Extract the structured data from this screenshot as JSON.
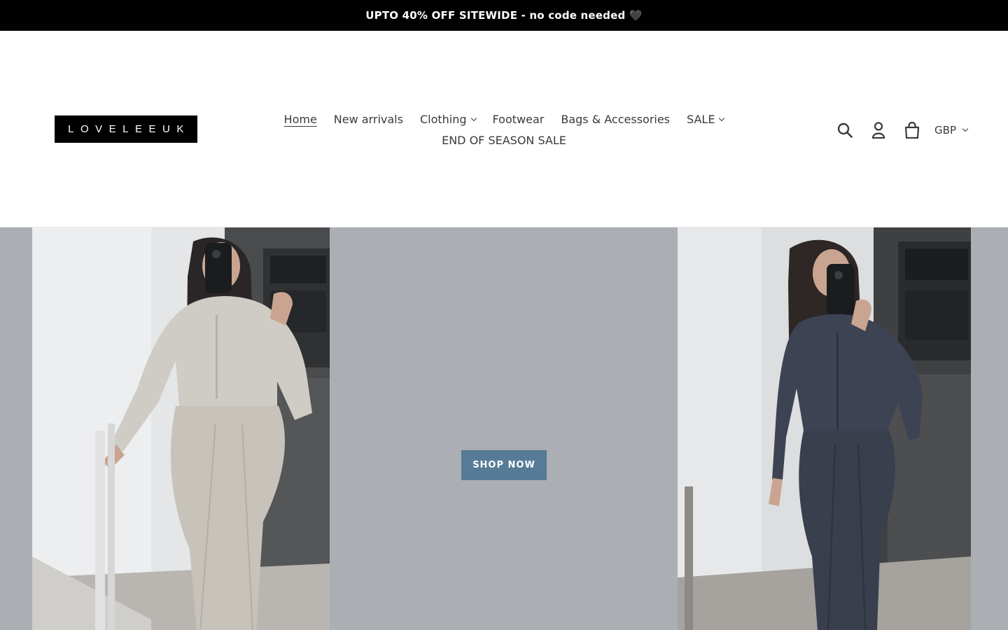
{
  "announcement": {
    "text": "UPTO 40% OFF SITEWIDE - no code needed 🖤"
  },
  "header": {
    "logo_text": "LOVELEEUK",
    "nav": {
      "row1": [
        {
          "label": "Home",
          "active": true,
          "dropdown": false
        },
        {
          "label": "New arrivals",
          "active": false,
          "dropdown": false
        },
        {
          "label": "Clothing",
          "active": false,
          "dropdown": true
        },
        {
          "label": "Footwear",
          "active": false,
          "dropdown": false
        },
        {
          "label": "Bags & Accessories",
          "active": false,
          "dropdown": false
        },
        {
          "label": "SALE",
          "active": false,
          "dropdown": true
        }
      ],
      "row2": [
        {
          "label": "END OF SEASON SALE",
          "active": false,
          "dropdown": false
        }
      ]
    },
    "icons": [
      "search-icon",
      "account-icon",
      "cart-icon"
    ],
    "currency": {
      "selected": "GBP"
    }
  },
  "hero": {
    "button_label": "SHOP NOW",
    "images": [
      {
        "alt": "beige-tracksuit-photo"
      },
      {
        "alt": "navy-tracksuit-photo"
      }
    ]
  },
  "colors": {
    "announcement_bg": "#000000",
    "button_bg": "#557b97",
    "hero_bg": "#abaeb2"
  }
}
